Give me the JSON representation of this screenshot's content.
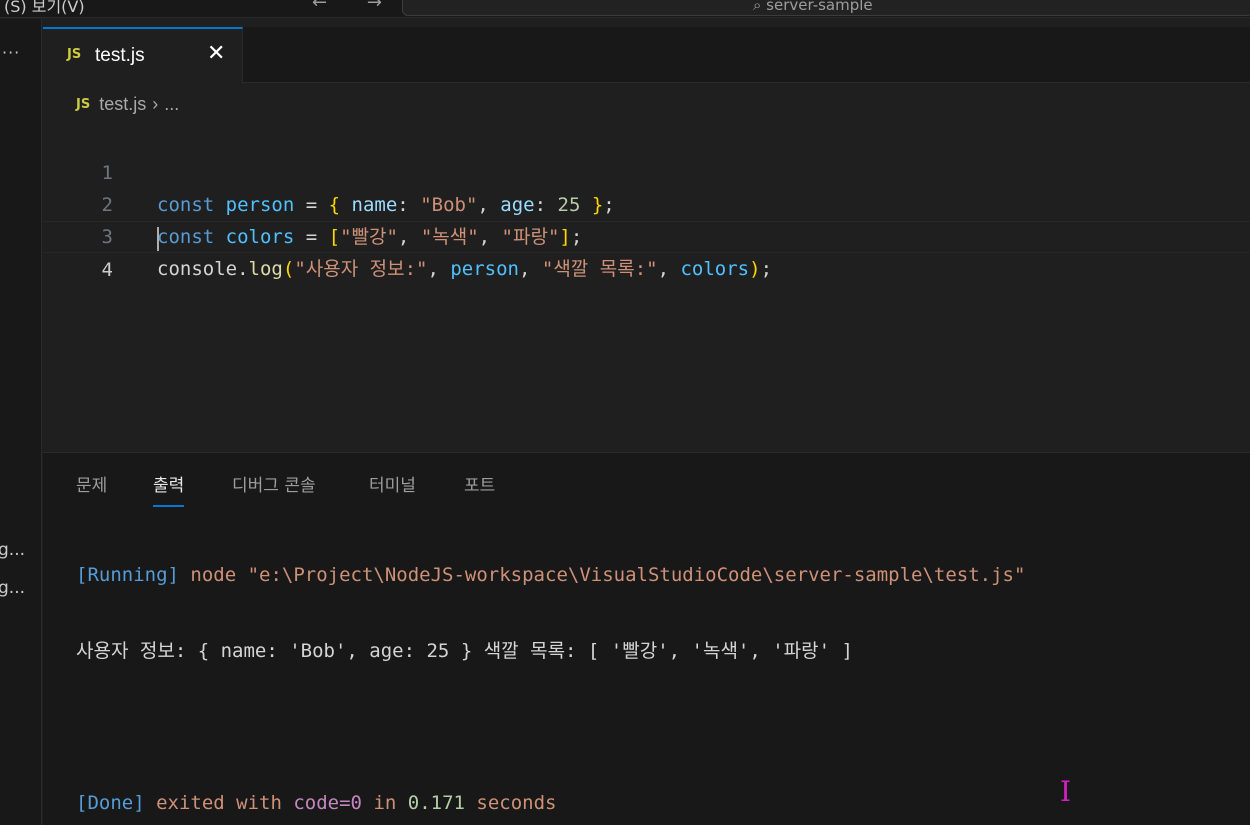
{
  "titlebar": {
    "menu_text": "(S)  보기(V)",
    "back_label": "←",
    "forward_label": "→",
    "command_center_text": "⌕ server-sample"
  },
  "sidebar": {
    "more_label": "···",
    "items": [
      "g...",
      "g..."
    ]
  },
  "editor": {
    "tab": {
      "icon": "JS",
      "label": "test.js",
      "close_label": "✕"
    },
    "breadcrumb": {
      "icon": "JS",
      "file": "test.js",
      "separator": "›",
      "more": "..."
    },
    "lines": [
      {
        "number": "1"
      },
      {
        "number": "2"
      },
      {
        "number": "3"
      },
      {
        "number": "4"
      }
    ],
    "code": {
      "l1": {
        "kw": "const",
        "var": "person",
        "eq": " = ",
        "open": "{",
        "k1": "name",
        "colon1": ": ",
        "v1": "\"Bob\"",
        "comma": ", ",
        "k2": "age",
        "colon2": ": ",
        "v2": "25",
        "close": "}",
        "end": ";"
      },
      "l2": {
        "kw": "const",
        "var": "colors",
        "eq": " = ",
        "open": "[",
        "s1": "\"빨강\"",
        "comma1": ", ",
        "s2": "\"녹색\"",
        "comma2": ", ",
        "s3": "\"파랑\"",
        "close": "]",
        "end": ";"
      },
      "l3": {
        "obj": "console",
        "dot": ".",
        "fn": "log",
        "open": "(",
        "s1": "\"사용자 정보:\"",
        "comma1": ", ",
        "a1": "person",
        "comma2": ", ",
        "s2": "\"색깔 목록:\"",
        "comma3": ", ",
        "a2": "colors",
        "close": ")",
        "end": ";"
      }
    }
  },
  "panel": {
    "tabs": [
      "문제",
      "출력",
      "디버그 콘솔",
      "터미널",
      "포트"
    ],
    "active_tab": "출력",
    "output": {
      "running_tag": "[Running]",
      "running_cmd": " node \"e:\\Project\\NodeJS-workspace\\VisualStudioCode\\server-sample\\test.js\"",
      "result": "사용자 정보: { name: 'Bob', age: 25 } 색깔 목록: [ '빨강', '녹색', '파랑' ]",
      "done_tag": "[Done]",
      "done_text1": " exited with ",
      "done_code": "code=0",
      "done_text2": " in ",
      "done_time": "0.171",
      "done_text3": " seconds"
    }
  },
  "colors": {
    "accent": "#0078d4",
    "js_icon": "#cbcb41",
    "mouse_cursor": "#d020c0"
  },
  "icons": {
    "mouse_cursor": "text-cursor-icon",
    "ibeam_glyph": "I"
  }
}
